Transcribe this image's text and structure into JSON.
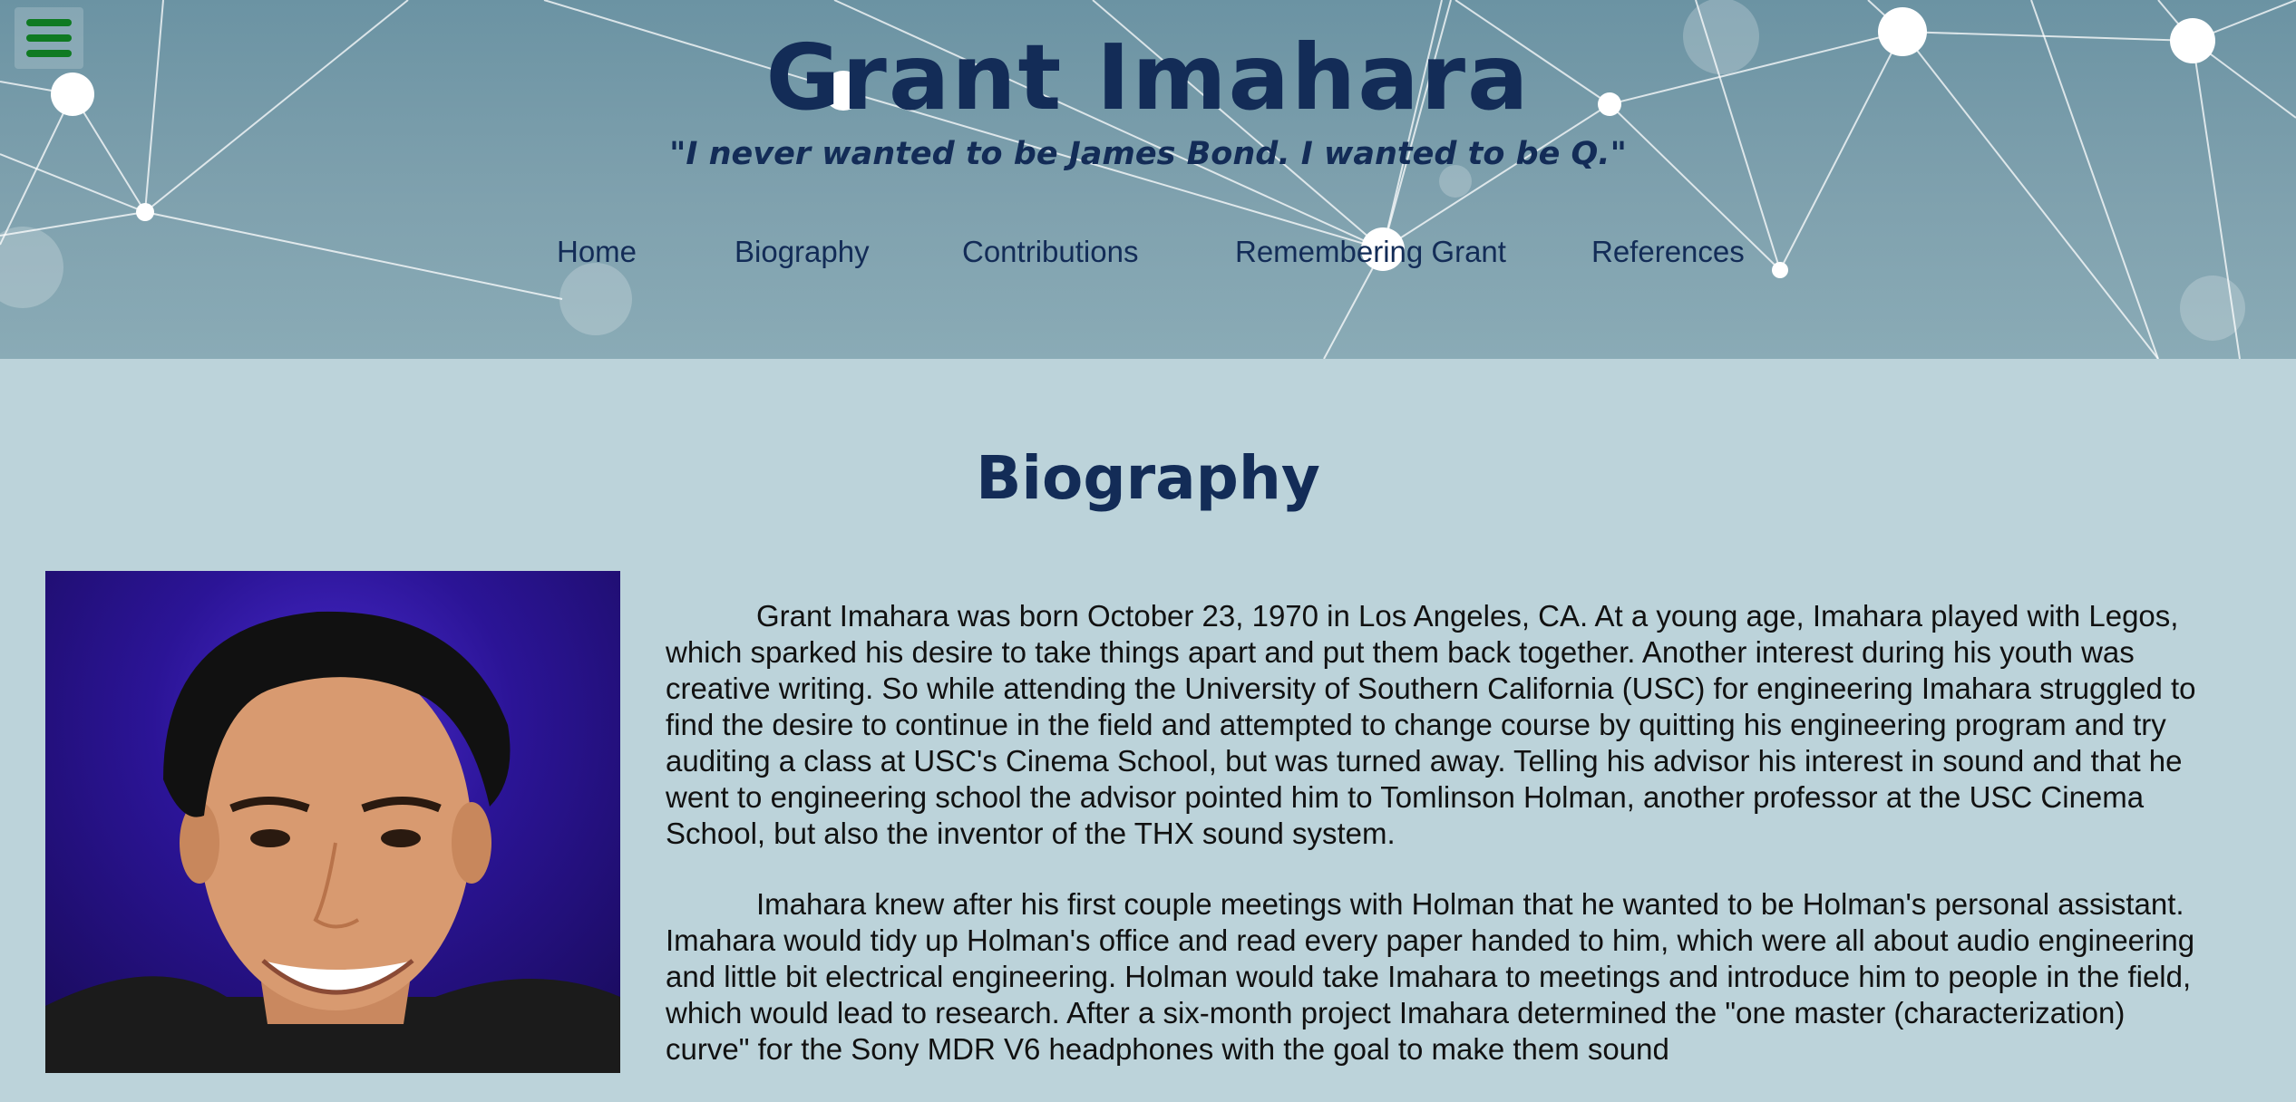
{
  "header": {
    "title": "Grant Imahara",
    "tagline": "\"I never wanted to be James Bond. I wanted to be Q.\"",
    "menu_icon": "hamburger-menu-icon"
  },
  "nav": {
    "items": [
      {
        "label": "Home"
      },
      {
        "label": "Biography"
      },
      {
        "label": "Contributions"
      },
      {
        "label": "Remembering Grant"
      },
      {
        "label": "References"
      }
    ]
  },
  "main": {
    "section_title": "Biography",
    "paragraphs": [
      "Grant Imahara was born October 23, 1970 in Los Angeles, CA. At a young age, Imahara played with Legos, which sparked his desire to take things apart and put them back together. Another interest during his youth was creative writing. So while attending the University of Southern California (USC) for engineering Imahara struggled to find the desire to continue in the field and attempted to change course by quitting his engineering program and try auditing a class at USC's Cinema School, but was turned away. Telling his advisor his interest in sound and that he went to engineering school the advisor pointed him to Tomlinson Holman, another professor at the USC Cinema School, but also the inventor of the THX sound system.",
      "Imahara knew after his first couple meetings with Holman that he wanted to be Holman's personal assistant. Imahara would tidy up Holman's office and read every paper handed to him, which were all about audio engineering and little bit electrical engineering. Holman would take Imahara to meetings and introduce him to people in the field, which would lead to research. After a six-month project Imahara determined the \"one master (characterization) curve\" for the Sony MDR V6 headphones with the goal to make them sound"
    ]
  },
  "colors": {
    "title": "#132c57",
    "menu_icon": "#0f7a22",
    "page_background": "#bcd3da",
    "header_background": "#7a9cab"
  }
}
